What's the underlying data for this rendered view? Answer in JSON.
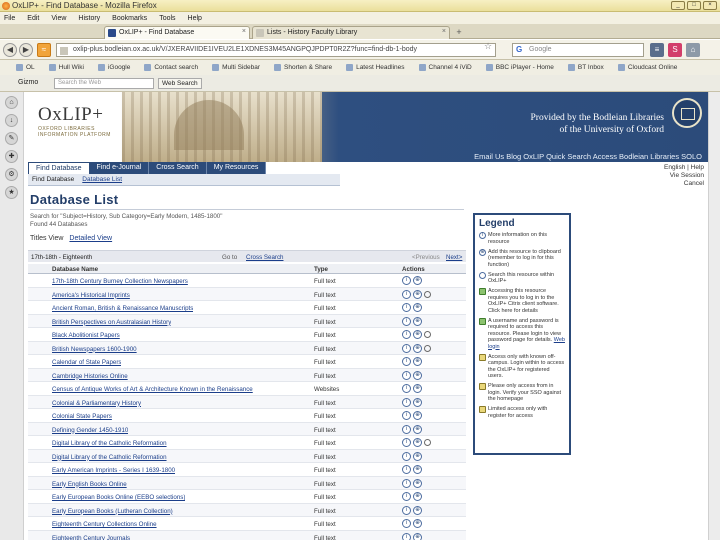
{
  "window": {
    "title": "OxLIP+ - Find Database - Mozilla Firefox"
  },
  "menu": [
    "File",
    "Edit",
    "View",
    "History",
    "Bookmarks",
    "Tools",
    "Help"
  ],
  "tabs": [
    {
      "label": "OxLIP+ - Find Database",
      "active": true
    },
    {
      "label": "Lists - History Faculty Library",
      "active": false
    }
  ],
  "nav": {
    "url": "oxlip-plus.bodleian.ox.ac.uk/V/JXERAVIIDE1IVEU2LE1XDNES3M45ANGPQJPDPT0R2Z?func=find-db-1-body",
    "search_placeholder": "Google"
  },
  "bookmarks": [
    "OL",
    "Hull Wiki",
    "iGoogle",
    "Contact search",
    "Multi Sidebar",
    "Shorten & Share",
    "Latest Headlines",
    "Channel 4 iViD",
    "BBC iPlayer - Home",
    "BT Inbox",
    "Cloudcast Online"
  ],
  "toolbar2": {
    "left_label": "Gizmo",
    "input_placeholder": "Search the Web",
    "search_button": "Web Search"
  },
  "banner": {
    "logo": "OxLIP+",
    "logo_sub": "OXFORD LIBRARIES INFORMATION PLATFORM",
    "provided_line1": "Provided by the Bodleian Libraries",
    "provided_line2": "of the University of Oxford",
    "links": "Email Us  Blog OxLIP  Quick Search  Access Bodleian Libraries SOLO"
  },
  "main_tabs": [
    "Find Database",
    "Find e-Journal",
    "Cross Search",
    "My Resources"
  ],
  "sub_nav": {
    "current": "Find Database",
    "link": "Database List"
  },
  "user_links": [
    "English | Help",
    "Vie Session",
    "Cancel"
  ],
  "content": {
    "title": "Database List",
    "search_for": "Search for \"Subject=History, Sub Category=Early Modern, 1485-1800\"",
    "found": "Found 44 Databases",
    "view_label": "Titles View",
    "view_link": "Detailed View",
    "pager": {
      "selection": "17th-18th - Eighteenth",
      "goto": "Go to",
      "cross_search": "Cross Search",
      "prev": "<Previous",
      "next": "Next>"
    },
    "columns": {
      "name": "Database Name",
      "type": "Type",
      "actions": "Actions"
    }
  },
  "databases": [
    {
      "name": "17th-18th Century Burney Collection Newspapers",
      "type": "Full text",
      "search": false
    },
    {
      "name": "America's Historical Imprints",
      "type": "Full text",
      "search": true
    },
    {
      "name": "Ancient Roman, British & Renaissance Manuscripts",
      "type": "Full text",
      "search": false
    },
    {
      "name": "British Perspectives on Australasian History",
      "type": "Full text",
      "search": false
    },
    {
      "name": "Black Abolitionist Papers",
      "type": "Full text",
      "search": true
    },
    {
      "name": "British Newspapers 1600-1900",
      "type": "Full text",
      "search": true
    },
    {
      "name": "Calendar of State Papers",
      "type": "Full text",
      "search": false
    },
    {
      "name": "Cambridge Histories Online",
      "type": "Full text",
      "search": false
    },
    {
      "name": "Census of Antique Works of Art & Architecture Known in the Renaissance",
      "type": "Websites",
      "search": false
    },
    {
      "name": "Colonial & Parliamentary History",
      "type": "Full text",
      "search": false
    },
    {
      "name": "Colonial State Papers",
      "type": "Full text",
      "search": false
    },
    {
      "name": "Defining Gender 1450-1910",
      "type": "Full text",
      "search": false
    },
    {
      "name": "Digital Library of the Catholic Reformation",
      "type": "Full text",
      "search": true
    },
    {
      "name": "Digital Library of the Catholic Reformation",
      "type": "Full text",
      "search": false
    },
    {
      "name": "Early American Imprints - Series I 1639-1800",
      "type": "Full text",
      "search": false
    },
    {
      "name": "Early English Books Online",
      "type": "Full text",
      "search": false
    },
    {
      "name": "Early European Books Online (EEBO selections)",
      "type": "Full text",
      "search": false
    },
    {
      "name": "Early European Books (Lutheran Collection)",
      "type": "Full text",
      "search": false
    },
    {
      "name": "Eighteenth Century Collections Online",
      "type": "Full text",
      "search": false
    },
    {
      "name": "Eighteenth Century Journals",
      "type": "Full text",
      "search": false
    }
  ],
  "legend": {
    "title": "Legend",
    "items": [
      {
        "icon": "i",
        "text": "More information on this resource"
      },
      {
        "icon": "s",
        "text": "Add this resource to clipboard (remember to log in for this function)"
      },
      {
        "icon": "q",
        "text": "Search this resource within OxLIP+"
      },
      {
        "icon": "g",
        "text": "Accessing this resource requires you to log in to the OxLIP+ Citrix client software. Click here for details"
      },
      {
        "icon": "g",
        "text": "A username and password is required to access this resource. Please login to view password page for details.",
        "link": "Web login"
      },
      {
        "icon": "k",
        "text": "Access only with known off-campus. Login within to access the OxLIP+ for registered users."
      },
      {
        "icon": "k",
        "text": "Please only access from in login. Verify your SSO against the homepage"
      },
      {
        "icon": "k",
        "text": "Limited access only with register for access"
      }
    ]
  }
}
